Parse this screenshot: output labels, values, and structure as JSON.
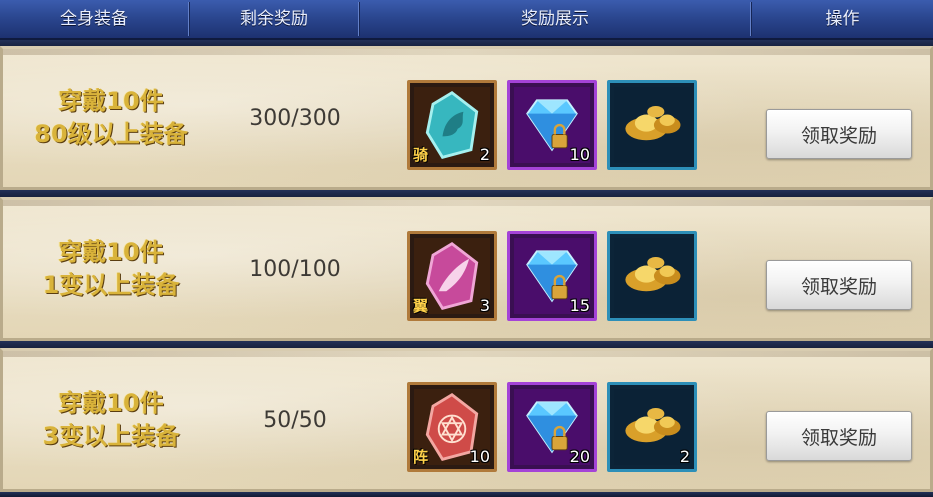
{
  "header": {
    "col_condition": "全身装备",
    "col_remaining": "剩余奖励",
    "col_rewards": "奖励展示",
    "col_action": "操作"
  },
  "rows": [
    {
      "condition_line1": "穿戴10件",
      "condition_line2": "80级以上装备",
      "remaining": "300/300",
      "items": [
        {
          "icon": "mount-crystal-icon",
          "tag": "骑",
          "count": "2",
          "quality": "orange"
        },
        {
          "icon": "locked-diamond-icon",
          "tag": "",
          "count": "10",
          "quality": "purple"
        },
        {
          "icon": "gold-ingot-icon",
          "tag": "",
          "count": "",
          "quality": "blue"
        }
      ],
      "button_label": "领取奖励"
    },
    {
      "condition_line1": "穿戴10件",
      "condition_line2": "1变以上装备",
      "remaining": "100/100",
      "items": [
        {
          "icon": "wing-crystal-icon",
          "tag": "翼",
          "count": "3",
          "quality": "orange"
        },
        {
          "icon": "locked-diamond-icon",
          "tag": "",
          "count": "15",
          "quality": "purple"
        },
        {
          "icon": "gold-ingot-icon",
          "tag": "",
          "count": "",
          "quality": "blue"
        }
      ],
      "button_label": "领取奖励"
    },
    {
      "condition_line1": "穿戴10件",
      "condition_line2": "3变以上装备",
      "remaining": "50/50",
      "items": [
        {
          "icon": "formation-crystal-icon",
          "tag": "阵",
          "count": "10",
          "quality": "orange"
        },
        {
          "icon": "locked-diamond-icon",
          "tag": "",
          "count": "20",
          "quality": "purple"
        },
        {
          "icon": "gold-ingot-icon",
          "tag": "",
          "count": "2",
          "quality": "blue"
        }
      ],
      "button_label": "领取奖励"
    }
  ],
  "colors": {
    "header_bg": "#2b4790",
    "condition_gold": "#d9b33a",
    "row_bg": "#e9dfc4",
    "orange_frame": "#b07a3b",
    "purple_frame": "#a443d7",
    "blue_frame": "#2d8fb8"
  }
}
